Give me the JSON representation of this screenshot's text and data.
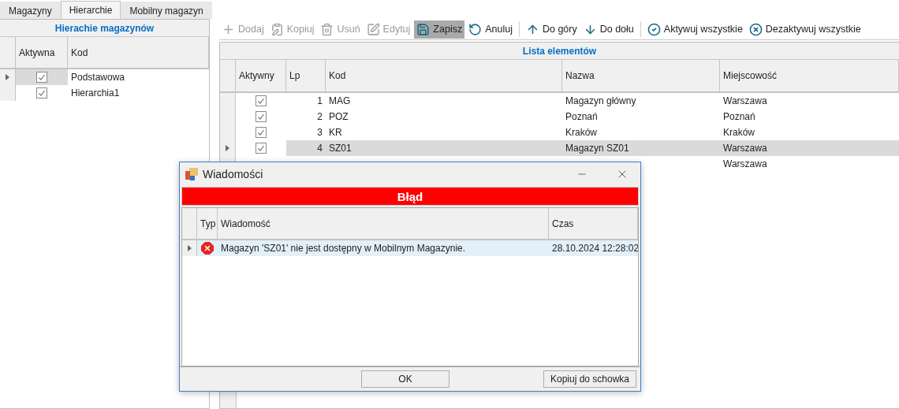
{
  "tabs": [
    {
      "label": "Magazyny",
      "selected": false
    },
    {
      "label": "Hierarchie",
      "selected": true
    },
    {
      "label": "Mobilny magazyn",
      "selected": false
    }
  ],
  "hierarchies": {
    "title": "Hierachie magazynów",
    "columns": [
      "Aktywna",
      "Kod"
    ],
    "rows": [
      {
        "active": true,
        "code": "Podstawowa",
        "selected": true
      },
      {
        "active": true,
        "code": "Hierarchia1",
        "selected": false
      }
    ]
  },
  "toolbar": [
    {
      "kind": "add",
      "label": "Dodaj",
      "disabled": true,
      "selected": false,
      "separator_after": false
    },
    {
      "kind": "copy",
      "label": "Kopiuj",
      "disabled": true,
      "selected": false,
      "separator_after": false
    },
    {
      "kind": "delete",
      "label": "Usuń",
      "disabled": true,
      "selected": false,
      "separator_after": false
    },
    {
      "kind": "edit",
      "label": "Edytuj",
      "disabled": true,
      "selected": false,
      "separator_after": false
    },
    {
      "kind": "save",
      "label": "Zapisz",
      "disabled": false,
      "selected": true,
      "separator_after": false
    },
    {
      "kind": "undo",
      "label": "Anuluj",
      "disabled": false,
      "selected": false,
      "separator_after": true
    },
    {
      "kind": "up",
      "label": "Do góry",
      "disabled": false,
      "selected": false,
      "separator_after": false
    },
    {
      "kind": "down",
      "label": "Do dołu",
      "disabled": false,
      "selected": false,
      "separator_after": true
    },
    {
      "kind": "activate",
      "label": "Aktywuj wszystkie",
      "disabled": false,
      "selected": false,
      "separator_after": false
    },
    {
      "kind": "deactivate",
      "label": "Dezaktywuj wszystkie",
      "disabled": false,
      "selected": false,
      "separator_after": false
    }
  ],
  "elements": {
    "title": "Lista elementów",
    "columns": [
      "Aktywny",
      "Lp",
      "Kod",
      "Nazwa",
      "Miejscowość"
    ],
    "rows": [
      {
        "active": true,
        "lp": "1",
        "code": "MAG",
        "name": "Magazyn główny",
        "city": "Warszawa",
        "selected": false
      },
      {
        "active": true,
        "lp": "2",
        "code": "POZ",
        "name": "Poznań",
        "city": "Poznań",
        "selected": false
      },
      {
        "active": true,
        "lp": "3",
        "code": "KR",
        "name": "Kraków",
        "city": "Kraków",
        "selected": false
      },
      {
        "active": true,
        "lp": "4",
        "code": "SZ01",
        "name": "Magazyn SZ01",
        "city": "Warszawa",
        "selected": true
      },
      {
        "city": "Warszawa",
        "selected": false
      }
    ]
  },
  "dialog": {
    "title": "Wiadomości",
    "banner": "Błąd",
    "columns": [
      "Typ",
      "Wiadomość",
      "Czas"
    ],
    "rows": [
      {
        "kind": "error",
        "message": "Magazyn 'SZ01' nie jest dostępny w Mobilnym Magazynie.",
        "time": "28.10.2024 12:28:02",
        "selected": true
      }
    ],
    "buttons": [
      "OK",
      "Kopiuj do schowka"
    ]
  }
}
